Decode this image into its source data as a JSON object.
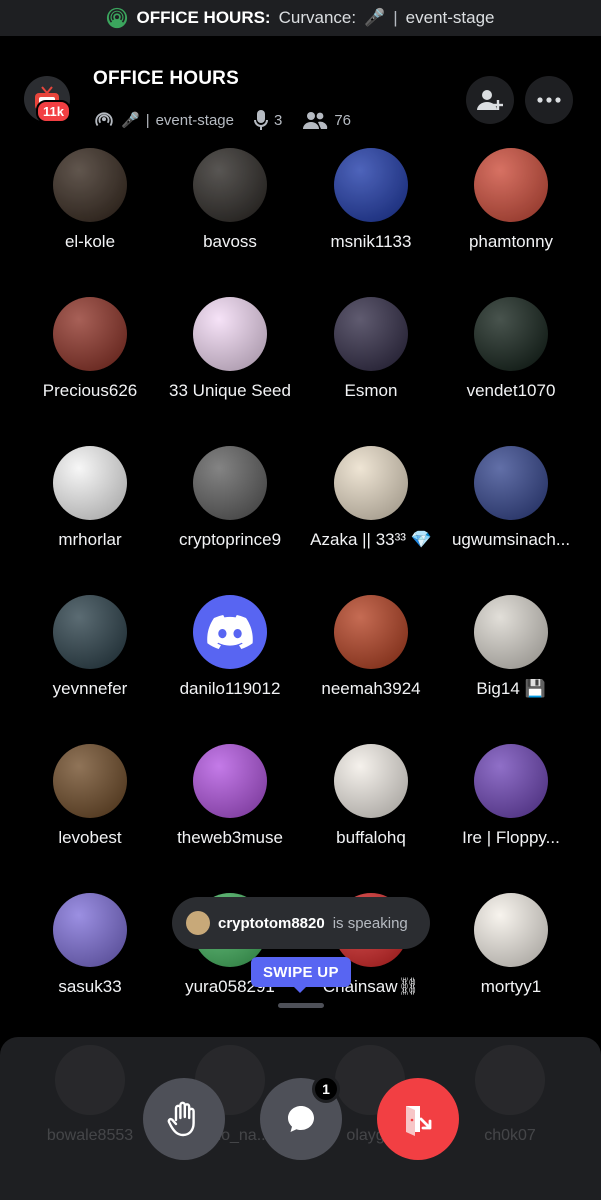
{
  "status_bar": {
    "label": "OFFICE HOURS:",
    "host": "Curvance:",
    "channel": "event-stage"
  },
  "header": {
    "title": "OFFICE HOURS",
    "channel": "event-stage",
    "speakers_count": "3",
    "listeners_count": "76",
    "tv_badge": "11k"
  },
  "participants": [
    {
      "name": "el-kole",
      "color": "#3a2a1e"
    },
    {
      "name": "bavoss",
      "color": "#2e2a26"
    },
    {
      "name": "msnik1133",
      "color": "#1f3fbf"
    },
    {
      "name": "phamtonny",
      "color": "#e9533e"
    },
    {
      "name": "Precious626",
      "color": "#8a2b1f"
    },
    {
      "name": "33 Unique Seed",
      "color": "#f3d9f5"
    },
    {
      "name": "Esmon",
      "color": "#2a2440"
    },
    {
      "name": "vendet1070",
      "color": "#0b1a12"
    },
    {
      "name": "mrhorlar",
      "color": "#f4f4f4"
    },
    {
      "name": "cryptoprince9",
      "color": "#5a5a5a"
    },
    {
      "name": "Azaka || 33³³ 💎",
      "color": "#e9dcc6"
    },
    {
      "name": "ugwumsinach...",
      "color": "#2d3f8a"
    },
    {
      "name": "yevnnefer",
      "color": "#243a44"
    },
    {
      "name": "danilo119012",
      "color": "#5865f2"
    },
    {
      "name": "neemah3924",
      "color": "#b23a1a"
    },
    {
      "name": "Big14 💾",
      "color": "#d8d4cc"
    },
    {
      "name": "levobest",
      "color": "#6a4520"
    },
    {
      "name": "theweb3muse",
      "color": "#b04ee0"
    },
    {
      "name": "buffalohq",
      "color": "#f2ede6"
    },
    {
      "name": "Ire | Floppy...",
      "color": "#6a3fb5"
    },
    {
      "name": "sasuk33",
      "color": "#7a6ad8"
    },
    {
      "name": "yura058291",
      "color": "#3db35a"
    },
    {
      "name": "Chainsaw⛓",
      "color": "#d61f1f"
    },
    {
      "name": "mortyy1",
      "color": "#f5f0e8"
    }
  ],
  "audience_ghost": [
    {
      "name": "bowale8553"
    },
    {
      "name": "mono_na..."
    },
    {
      "name": "olaygo"
    },
    {
      "name": "ch0k07"
    }
  ],
  "speaking_toast": {
    "user": "cryptotom8820",
    "suffix": "is speaking"
  },
  "swipe_hint": "SWIPE UP",
  "controls": {
    "chat_badge": "1"
  },
  "colors": {
    "accent": "#5865f2",
    "danger": "#f23f43",
    "live_green": "#3ba55d"
  }
}
